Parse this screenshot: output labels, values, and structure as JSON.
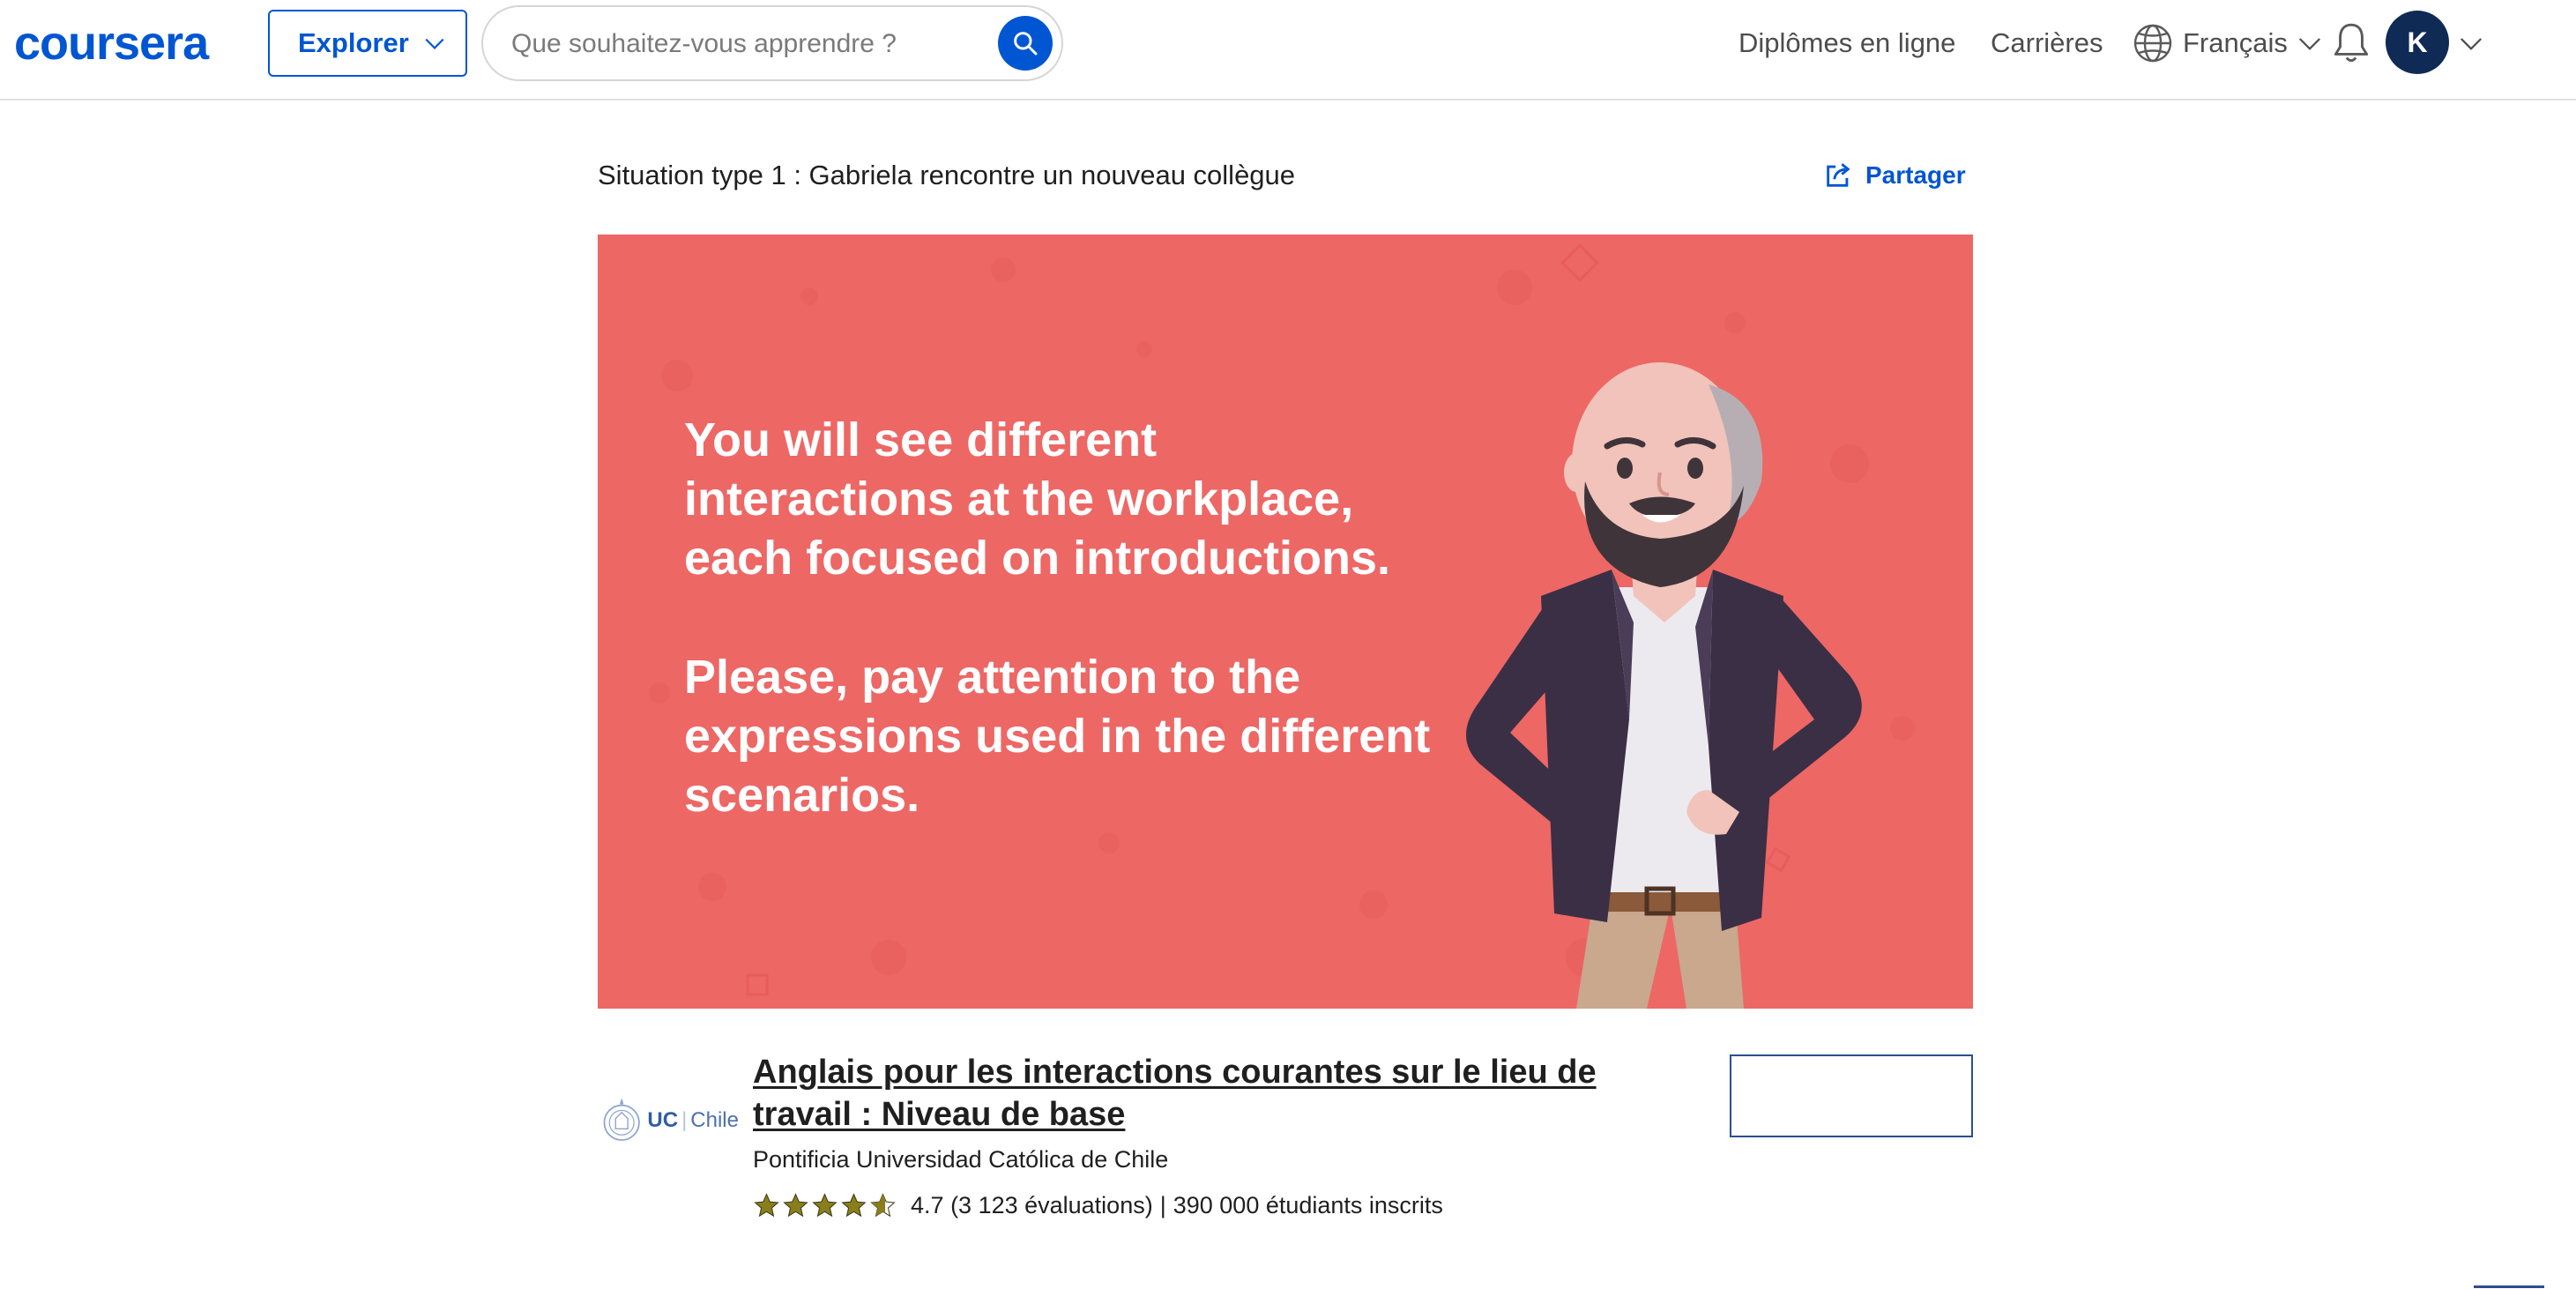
{
  "header": {
    "logo_text": "coursera",
    "explore_label": "Explorer",
    "search_placeholder": "Que souhaitez-vous apprendre ?",
    "nav_degrees": "Diplômes en ligne",
    "nav_careers": "Carrières",
    "language": "Français",
    "avatar_initial": "K"
  },
  "video": {
    "title": "Situation type 1 : Gabriela rencontre un nouveau collègue",
    "share_label": "Partager",
    "slide_paragraph_1": [
      "You will see different",
      "interactions at the workplace,",
      "each focused on introductions."
    ],
    "slide_paragraph_2": [
      "Please, pay attention to the",
      "expressions used in the different",
      "scenarios."
    ]
  },
  "course": {
    "logo_mark": "UC",
    "logo_sub": "Chile",
    "title": "Anglais pour les interactions courantes sur le lieu de travail : Niveau de base",
    "provider": "Pontificia Universidad Católica de Chile",
    "rating": "4.7",
    "reviews": "(3 123 évaluations)",
    "separator": "|",
    "enrolled": "390 000 étudiants inscrits",
    "stars_value": 4.7
  },
  "colors": {
    "brand": "#0056d2",
    "slide_background": "#ed6765",
    "avatar": "#0f2a55"
  }
}
